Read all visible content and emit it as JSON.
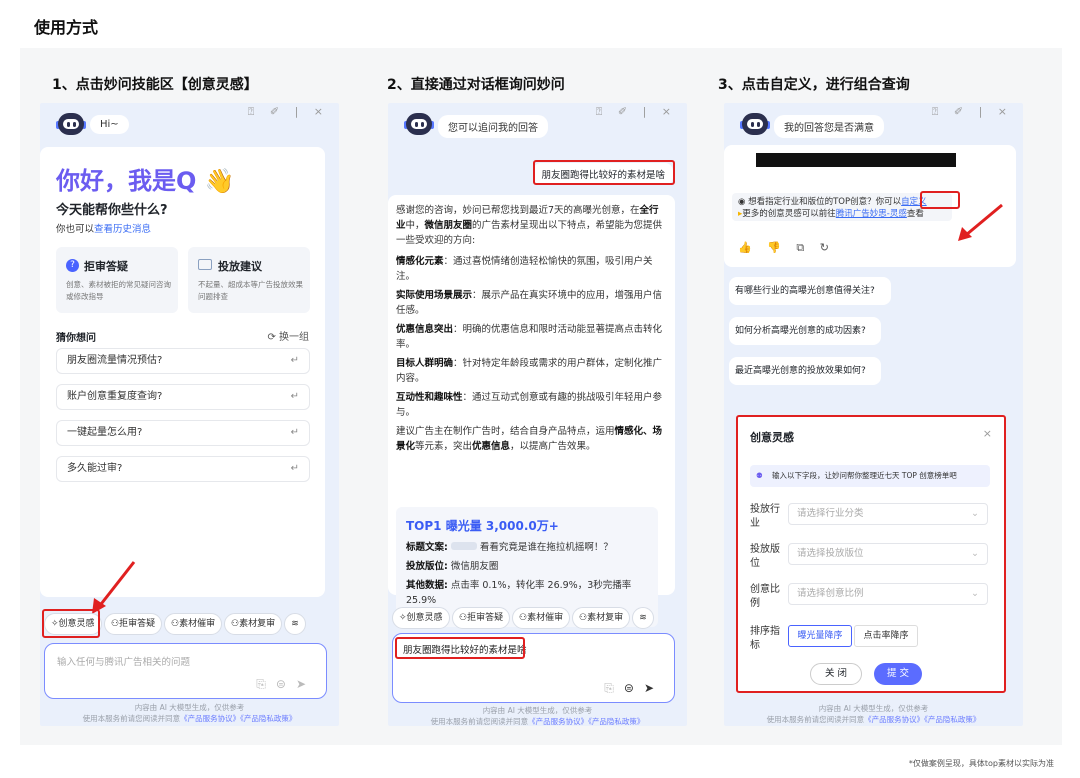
{
  "page_title": "使用方式",
  "footnote": "*仅做案例呈现，具体top素材以实际为准",
  "steps": [
    "1、点击妙问技能区【创意灵感】",
    "2、直接通过对话框询问妙问",
    "3、点击自定义，进行组合查询"
  ],
  "common": {
    "topbar_icons": "⍰ ✐ | ×",
    "footer_line1": "内容由 AI 大模型生成，仅供参考",
    "footer_line2_prefix": "使用本服务前请您阅读并同意",
    "footer_link1": "《产品服务协议》",
    "footer_link2": "《产品隐私政策》",
    "tools": [
      "创意灵感",
      "拒审答疑",
      "素材催审",
      "素材复审"
    ],
    "more_icon": "layers-icon"
  },
  "panel1": {
    "greeting_bubble": "Hi~",
    "hello": "你好，我是Q 👋",
    "subtitle": "今天能帮你些什么?",
    "history_prefix": "你也可以",
    "history_link": "查看历史消息",
    "feature1": {
      "title": "拒审答疑",
      "desc": "创意、素材被拒的常见疑问咨询或修改指导"
    },
    "feature2": {
      "title": "投放建议",
      "desc": "不起量、超成本等广告投放效果问题排查"
    },
    "guess_title": "猜你想问",
    "refresh": "换一组",
    "questions": [
      "朋友圈流量情况预估?",
      "账户创意重复度查询?",
      "一键起量怎么用?",
      "多久能过审?"
    ],
    "input_placeholder": "输入任何与腾讯广告相关的问题"
  },
  "panel2": {
    "greeting_bubble": "您可以追问我的回答",
    "user_msg": "朋友圈跑得比较好的素材是啥",
    "answer_intro_1": "感谢您的咨询，妙问已帮您找到最近7天的高曝光创意，在",
    "answer_bold_1": "全行业",
    "answer_intro_2": "中，",
    "answer_bold_2": "微信朋友圈",
    "answer_intro_3": "的广告素材呈现出以下特点，希望能为您提供一些受欢迎的方向:",
    "points": [
      {
        "title": "情感化元素",
        "text": "：通过喜悦情绪创造轻松愉快的氛围，吸引用户关注。"
      },
      {
        "title": "实际使用场景展示",
        "text": "：展示产品在真实环境中的应用，增强用户信任感。"
      },
      {
        "title": "优惠信息突出",
        "text": "：明确的优惠信息和限时活动能显著提高点击转化率。"
      },
      {
        "title": "目标人群明确",
        "text": "：针对特定年龄段或需求的用户群体，定制化推广内容。"
      },
      {
        "title": "互动性和趣味性",
        "text": "：通过互动式创意或有趣的挑战吸引年轻用户参与。"
      }
    ],
    "suggest_1": "建议广告主在制作广告时，结合自身产品特点，运用",
    "suggest_b1": "情感化、场景化",
    "suggest_2": "等元素，突出",
    "suggest_b2": "优惠信息",
    "suggest_3": "，以提高广告效果。",
    "top1_title": "TOP1 曝光量 3,000.0万+",
    "top1_copy_label": "标题文案:",
    "top1_copy_value": "看看究竟是谁在拖拉机摇啊！？",
    "top1_pos_label": "投放版位:",
    "top1_pos_value": "微信朋友圈",
    "top1_other_label": "其他数据:",
    "top1_other_value": "点击率 0.1%，转化率 26.9%，3秒完播率 25.9%",
    "input_value": "朋友圈跑得比较好的素材是啥"
  },
  "panel3": {
    "greeting_bubble": "我的回答您是否满意",
    "tip_line1_prefix": "◉ 想看指定行业和版位的TOP创意？你可以",
    "tip_custom": "自定义",
    "tip_line2_prefix": "更多的创意灵感可以前往",
    "tip_line2_link": "腾讯广告妙思-灵感",
    "tip_line2_suffix": "查看",
    "action_icons": "👍 👎 ⧉ ↻",
    "suggestions": [
      "有哪些行业的高曝光创意值得关注?",
      "如何分析高曝光创意的成功因素?",
      "最近高曝光创意的投放效果如何?"
    ],
    "form": {
      "title": "创意灵感",
      "close": "×",
      "notice": "输入以下字段，让妙问帮你整理近七天 TOP 创意榜单吧",
      "fields": [
        {
          "label": "投放行业",
          "placeholder": "请选择行业分类"
        },
        {
          "label": "投放版位",
          "placeholder": "请选择投放版位"
        },
        {
          "label": "创意比例",
          "placeholder": "请选择创意比例"
        }
      ],
      "sort_label": "排序指标",
      "sort_options": [
        "曝光量降序",
        "点击率降序"
      ],
      "cancel": "关 闭",
      "submit": "提 交"
    }
  },
  "colors": {
    "accent": "#5b6cff",
    "highlight": "#e02020",
    "panel_bg": "#eaf0fb"
  }
}
